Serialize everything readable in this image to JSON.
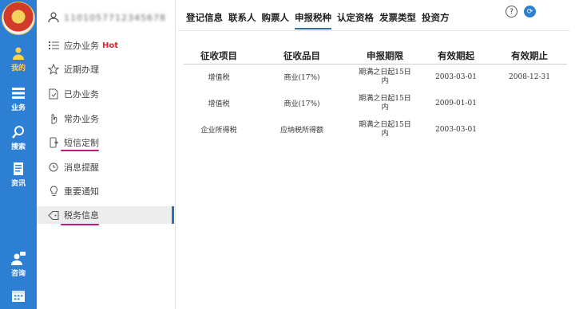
{
  "rail": {
    "items": [
      {
        "label": "我的",
        "icon": "user-icon"
      },
      {
        "label": "业务",
        "icon": "list-icon"
      },
      {
        "label": "搜索",
        "icon": "search-icon"
      },
      {
        "label": "资讯",
        "icon": "document-icon"
      },
      {
        "label": "咨询",
        "icon": "chat-user-icon"
      },
      {
        "label": "",
        "icon": "calendar-icon"
      }
    ],
    "active_color": "#ffd24a"
  },
  "sidebar": {
    "user_name": "1101057712345678",
    "items": [
      {
        "label": "应办业务",
        "badge": "Hot",
        "icon": "todo-list-icon"
      },
      {
        "label": "近期办理",
        "icon": "star-icon"
      },
      {
        "label": "已办业务",
        "icon": "done-document-icon"
      },
      {
        "label": "常办业务",
        "icon": "pointer-icon"
      },
      {
        "label": "短信定制",
        "icon": "phone-icon"
      },
      {
        "label": "消息提醒",
        "icon": "clock-icon"
      },
      {
        "label": "重要通知",
        "icon": "lightbulb-icon"
      },
      {
        "label": "税务信息",
        "icon": "tag-icon"
      }
    ]
  },
  "tabs": [
    "登记信息",
    "联系人",
    "购票人",
    "申报税种",
    "认定资格",
    "发票类型",
    "投资方"
  ],
  "active_tab": "申报税种",
  "top_icons": {
    "help": "?",
    "update": "⟳"
  },
  "table": {
    "headers": [
      "征收项目",
      "征收品目",
      "申报期限",
      "有效期起",
      "有效期止"
    ],
    "rows": [
      [
        "增值税",
        "商业(17%)",
        "期满之日起15日内",
        "2003-03-01",
        "2008-12-31"
      ],
      [
        "增值税",
        "商业(17%)",
        "期满之日起15日内",
        "2009-01-01",
        ""
      ],
      [
        "企业所得税",
        "应纳税所得额",
        "期满之日起15日内",
        "2003-03-01",
        ""
      ]
    ]
  },
  "colors": {
    "accent": "#2d7fd3",
    "highlight": "#c8167a",
    "hot": "#d8292f"
  }
}
